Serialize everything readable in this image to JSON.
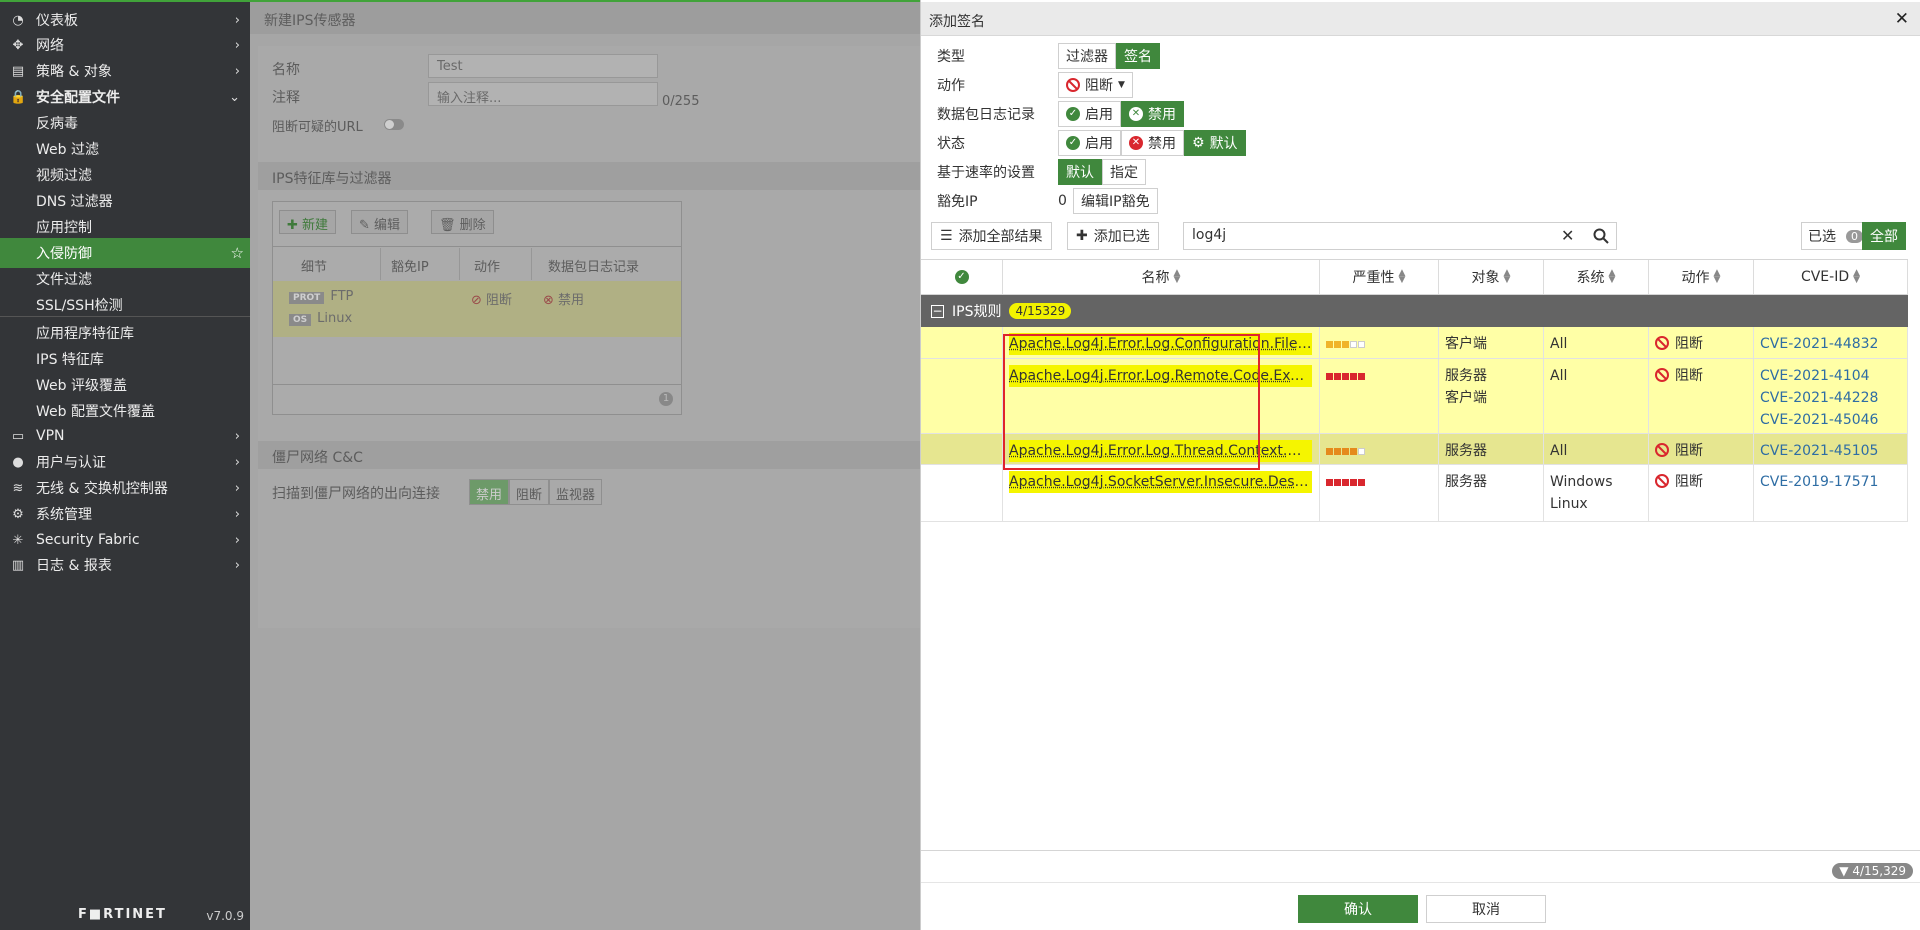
{
  "sidebar": {
    "items": [
      {
        "label": "仪表板",
        "icon": "dashboard-icon",
        "chevron": "›"
      },
      {
        "label": "网络",
        "icon": "network-icon",
        "chevron": "›"
      },
      {
        "label": "策略 & 对象",
        "icon": "policy-icon",
        "chevron": "›"
      },
      {
        "label": "安全配置文件",
        "icon": "lock-icon",
        "chevron": "⌄"
      },
      {
        "label": "反病毒"
      },
      {
        "label": "Web 过滤"
      },
      {
        "label": "视频过滤"
      },
      {
        "label": "DNS 过滤器"
      },
      {
        "label": "应用控制"
      },
      {
        "label": "入侵防御"
      },
      {
        "label": "文件过滤"
      },
      {
        "label": "SSL/SSH检测"
      },
      {
        "label": "应用程序特征库"
      },
      {
        "label": "IPS 特征库"
      },
      {
        "label": "Web 评级覆盖"
      },
      {
        "label": "Web 配置文件覆盖"
      },
      {
        "label": "VPN",
        "icon": "vpn-icon",
        "chevron": "›"
      },
      {
        "label": "用户与认证",
        "icon": "user-icon",
        "chevron": "›"
      },
      {
        "label": "无线 & 交换机控制器",
        "icon": "wifi-icon",
        "chevron": "›"
      },
      {
        "label": "系统管理",
        "icon": "gear-icon",
        "chevron": "›"
      },
      {
        "label": "Security Fabric",
        "icon": "fabric-icon",
        "chevron": "›"
      },
      {
        "label": "日志 & 报表",
        "icon": "chart-icon",
        "chevron": "›"
      }
    ],
    "logo": "F■RTINET",
    "version": "v7.0.9"
  },
  "bg": {
    "title": "新建IPS传感器",
    "name_label": "名称",
    "name_value": "Test",
    "comment_label": "注释",
    "comment_placeholder": "输入注释...",
    "comment_count": "0/255",
    "block_url_label": "阻断可疑的URL",
    "sect_sigs": "IPS特征库与过滤器",
    "btn_new": "新建",
    "btn_edit": "编辑",
    "btn_delete": "删除",
    "col_detail": "细节",
    "col_exempt": "豁免IP",
    "col_action": "动作",
    "col_pktlog": "数据包日志记录",
    "tag_prot": "PROT",
    "val_prot": "FTP",
    "tag_os": "OS",
    "val_os": "Linux",
    "row_action": "阻断",
    "row_pktlog": "禁用",
    "grid_count": "1",
    "sect_botnet": "僵尸网络 C&C",
    "botnet_label": "扫描到僵尸网络的出向连接",
    "botnet_opts": [
      "禁用",
      "阻断",
      "监视器"
    ]
  },
  "dialog": {
    "title": "添加签名",
    "type_label": "类型",
    "type_opts": [
      "过滤器",
      "签名"
    ],
    "action_label": "动作",
    "action_value": "阻断",
    "pktlog_label": "数据包日志记录",
    "pktlog_opts": [
      "启用",
      "禁用"
    ],
    "status_label": "状态",
    "status_opts": [
      "启用",
      "禁用",
      "默认"
    ],
    "rate_label": "基于速率的设置",
    "rate_opts": [
      "默认",
      "指定"
    ],
    "exempt_label": "豁免IP",
    "exempt_count": "0",
    "exempt_btn": "编辑IP豁免",
    "btn_add_all": "添加全部结果",
    "btn_add_sel": "添加已选",
    "search_value": "log4j",
    "selected_label": "已选",
    "selected_count": "0",
    "all_label": "全部",
    "cols": {
      "name": "名称",
      "severity": "严重性",
      "target": "对象",
      "os": "系统",
      "action": "动作",
      "cve": "CVE-ID"
    },
    "group_label": "IPS规则",
    "group_count": "4/15329",
    "rows": [
      {
        "name": "Apache.Log4j.Error.Log.Configuration.File.R...",
        "severity": 3,
        "target": [
          "客户端"
        ],
        "os": [
          "All"
        ],
        "action": "阻断",
        "cve": [
          "CVE-2021-44832"
        ]
      },
      {
        "name": "Apache.Log4j.Error.Log.Remote.Code.Execu...",
        "severity": 5,
        "target": [
          "服务器",
          "客户端"
        ],
        "os": [
          "All"
        ],
        "action": "阻断",
        "cve": [
          "CVE-2021-4104",
          "CVE-2021-44228",
          "CVE-2021-45046"
        ]
      },
      {
        "name": "Apache.Log4j.Error.Log.Thread.Context.DoS",
        "severity": 4,
        "target": [
          "服务器"
        ],
        "os": [
          "All"
        ],
        "action": "阻断",
        "cve": [
          "CVE-2021-45105"
        ]
      },
      {
        "name": "Apache.Log4j.SocketServer.Insecure.Deseri...",
        "severity": 5,
        "target": [
          "服务器"
        ],
        "os": [
          "Windows",
          "Linux"
        ],
        "action": "阻断",
        "cve": [
          "CVE-2019-17571"
        ]
      }
    ],
    "total": "4/15,329",
    "ok": "确认",
    "cancel": "取消"
  },
  "colors": {
    "accent": "#40883d",
    "highlight": "#f5f500",
    "sev_high": "#d9272e",
    "sev_med": "#e58a1c",
    "sev_low": "#f0b429",
    "link": "#2e6da4"
  }
}
